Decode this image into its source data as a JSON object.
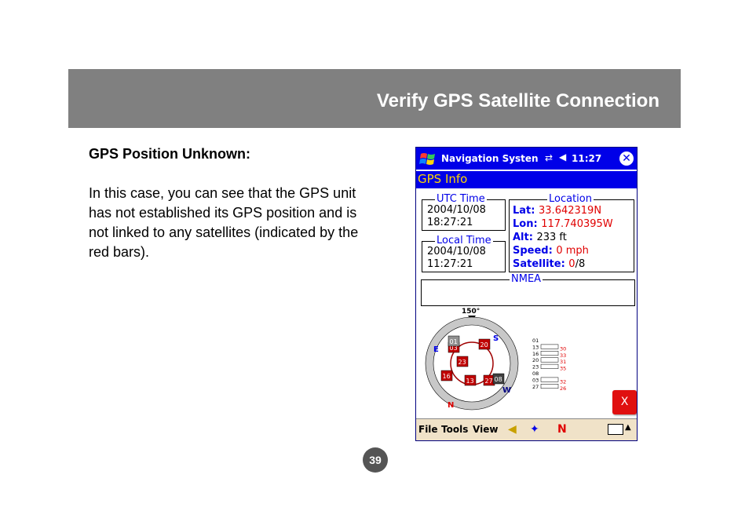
{
  "header": {
    "title": "Verify GPS Satellite Connection"
  },
  "content": {
    "heading": "GPS Position Unknown:",
    "body": "In this case, you can see that the GPS unit has not established its GPS position and is not linked to any satellites (indicated by the red bars)."
  },
  "page_number": "39",
  "device": {
    "taskbar": {
      "app_title": "Navigation Systen",
      "time": "11:27"
    },
    "screen_title": "GPS Info",
    "utc": {
      "label": "UTC Time",
      "date": "2004/10/08",
      "time": "18:27:21"
    },
    "local": {
      "label": "Local Time",
      "date": "2004/10/08",
      "time": "11:27:21"
    },
    "location": {
      "label": "Location",
      "lat_label": "Lat:",
      "lat_value": "33.642319N",
      "lon_label": "Lon:",
      "lon_value": "117.740395W",
      "alt_label": "Alt:",
      "alt_value": "233 ft",
      "speed_label": "Speed:",
      "speed_value": "0 mph",
      "sat_label": "Satellite:",
      "sat_used": "0",
      "sat_total": "/8"
    },
    "nmea_label": "NMEA",
    "sky": {
      "heading": "150°",
      "compass": {
        "n": "N",
        "s": "S",
        "e": "E",
        "w": "W"
      },
      "satellites": [
        "03",
        "20",
        "23",
        "16",
        "13",
        "27",
        "08",
        "01"
      ]
    },
    "signals": {
      "ids": [
        "01",
        "13",
        "16",
        "20",
        "23",
        "08",
        "03",
        "27"
      ],
      "values": [
        "",
        "30",
        "33",
        "31",
        "35",
        "",
        "32",
        "26"
      ]
    },
    "close_label": "X",
    "menu": {
      "file": "File",
      "tools": "Tools",
      "view": "View"
    },
    "colors": {
      "title_bar": "#0000e8",
      "error": "#e00000",
      "menu_bar": "#f0e2c8"
    }
  }
}
